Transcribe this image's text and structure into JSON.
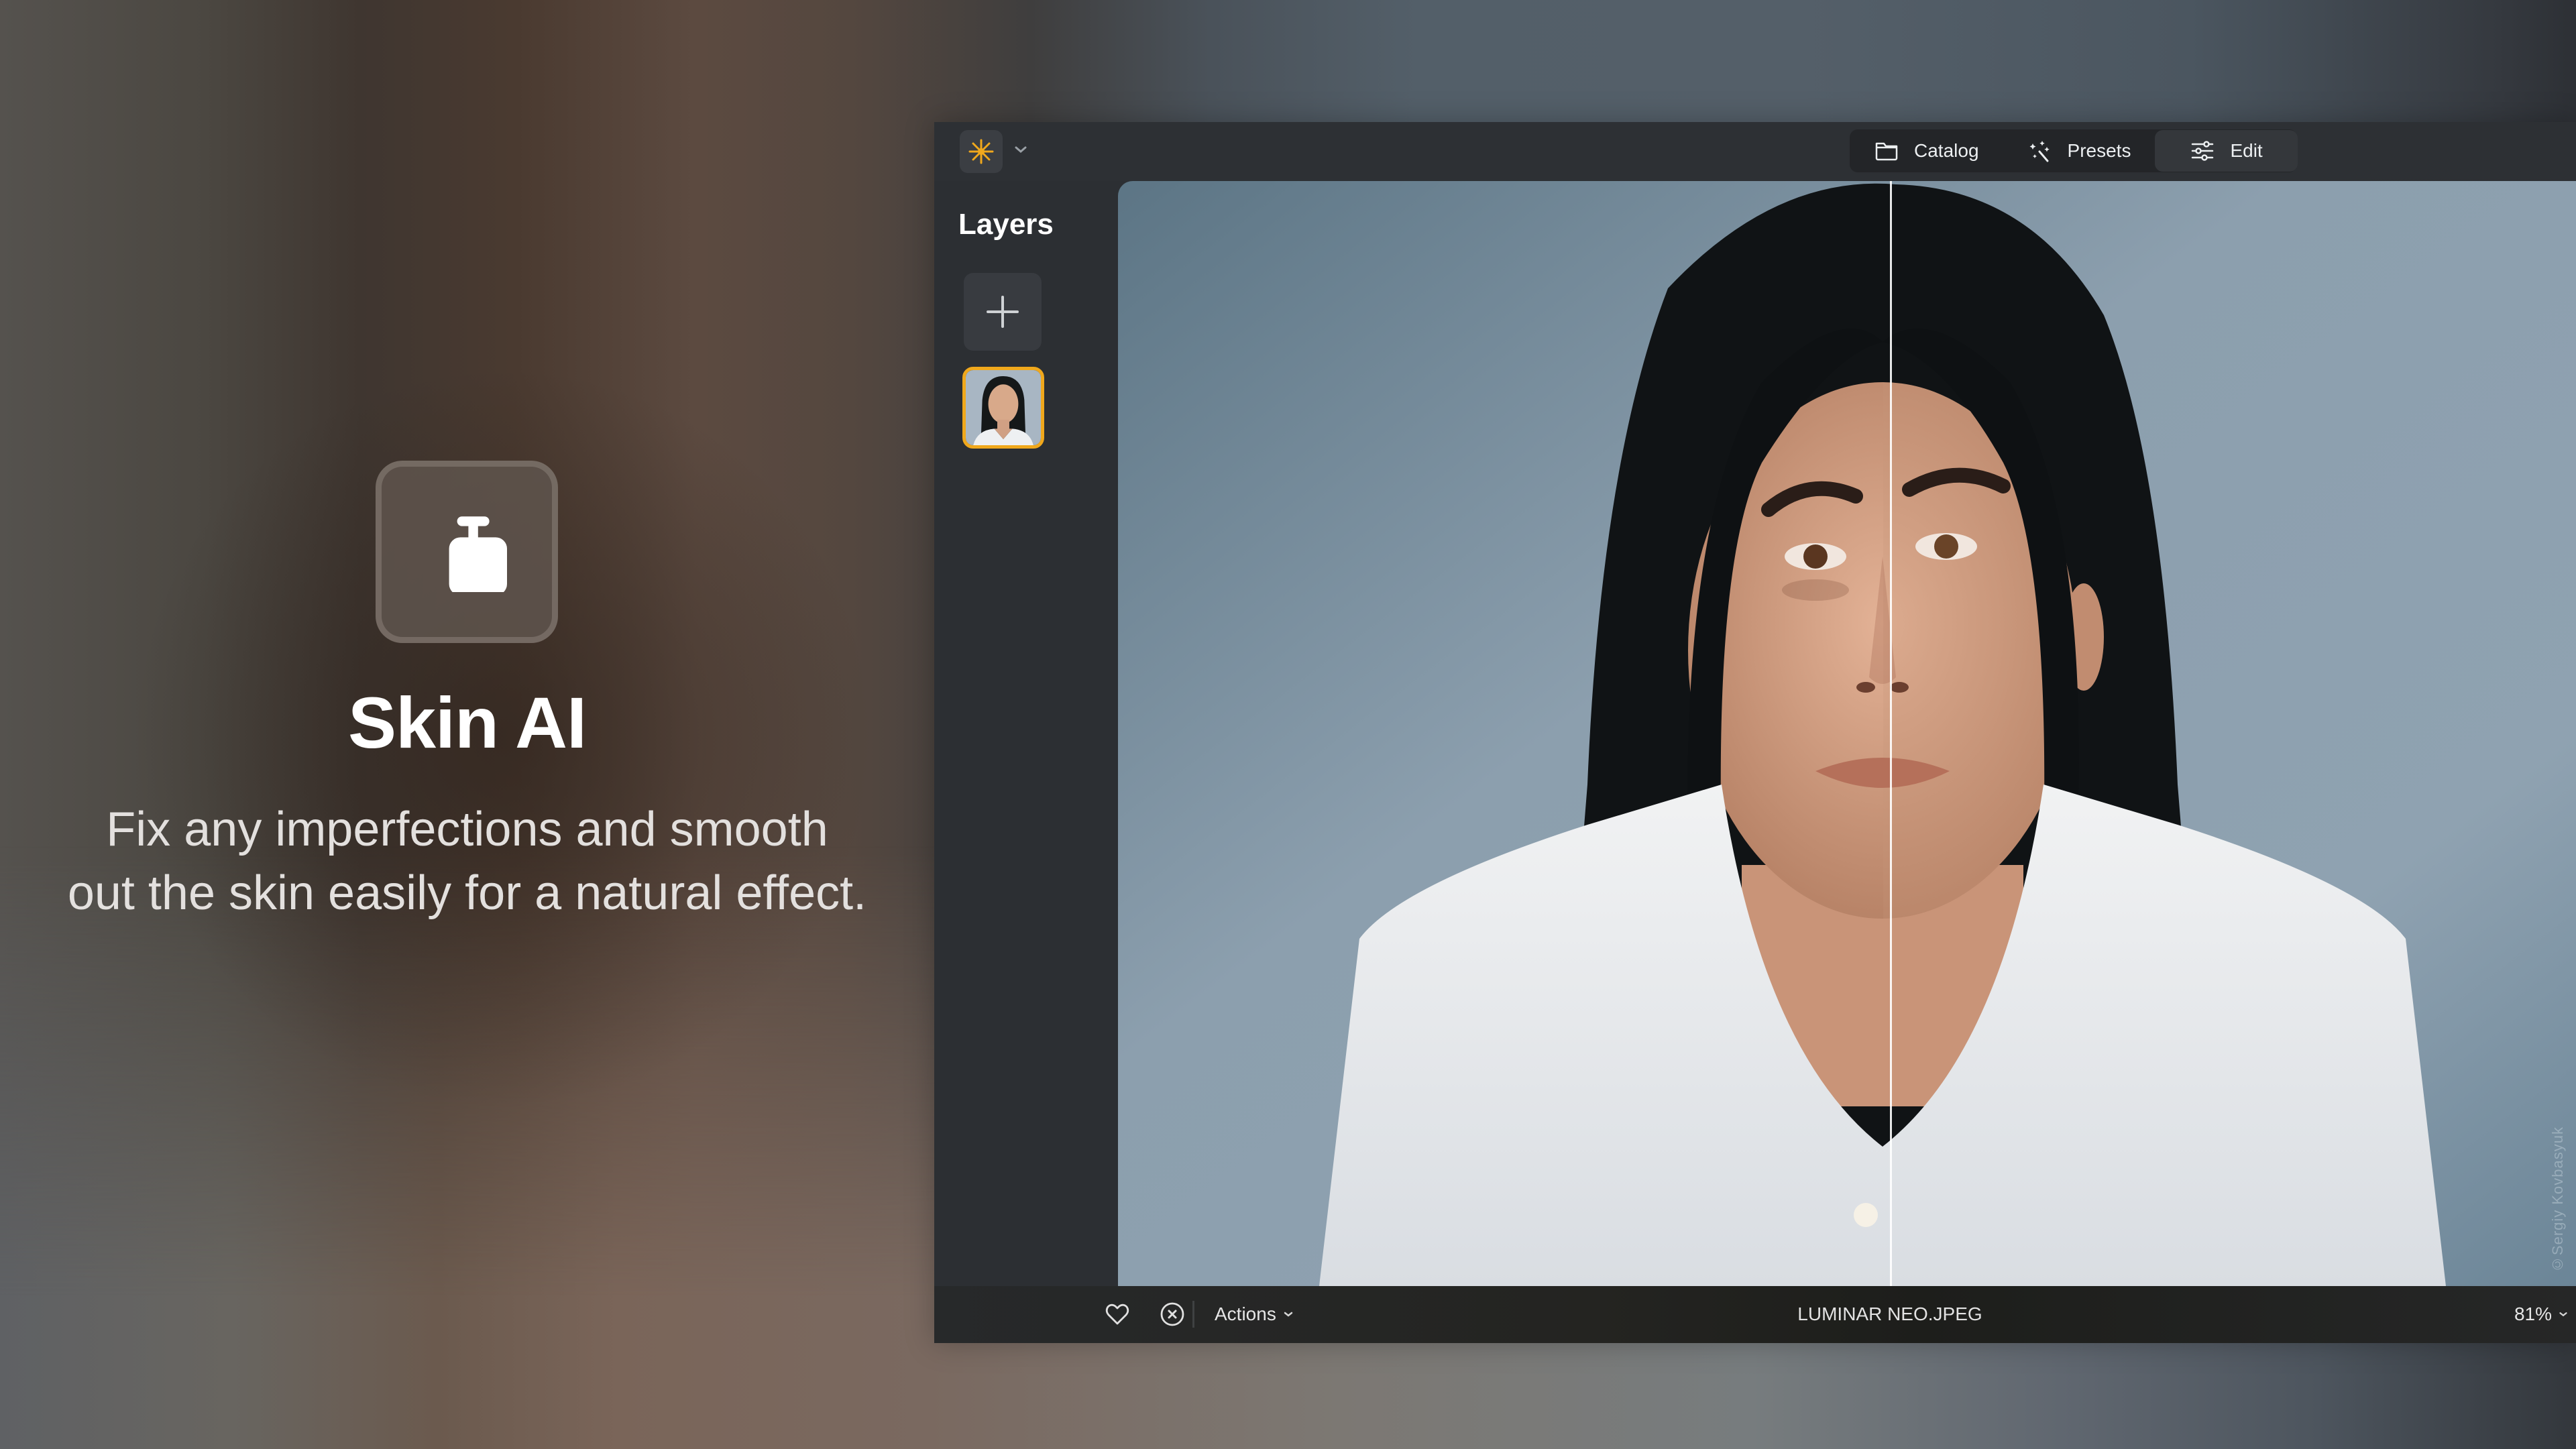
{
  "promo": {
    "icon": "skin-bottle-icon",
    "title": "Skin AI",
    "body": "Fix any imperfections and smooth out the skin easily for a natural effect."
  },
  "app": {
    "logo_icon": "luminar-sun-icon",
    "accent_color": "#f0a81c",
    "modes": [
      {
        "label": "Catalog",
        "icon": "folder-icon",
        "active": false
      },
      {
        "label": "Presets",
        "icon": "magic-wand-icon",
        "active": false
      },
      {
        "label": "Edit",
        "icon": "sliders-icon",
        "active": true
      }
    ],
    "sidebar": {
      "title": "Layers",
      "add_button_icon": "plus-icon",
      "layers": [
        {
          "name": "portrait-layer",
          "selected": true
        }
      ]
    },
    "canvas": {
      "before_after_split": 0.53,
      "watermark": "©Sergiy Kovbasyuk"
    },
    "bottombar": {
      "favorite_icon": "heart-icon",
      "reject_icon": "reject-circle-x-icon",
      "actions_label": "Actions",
      "filename": "LUMINAR NEO.JPEG",
      "zoom_level": "81%"
    }
  }
}
